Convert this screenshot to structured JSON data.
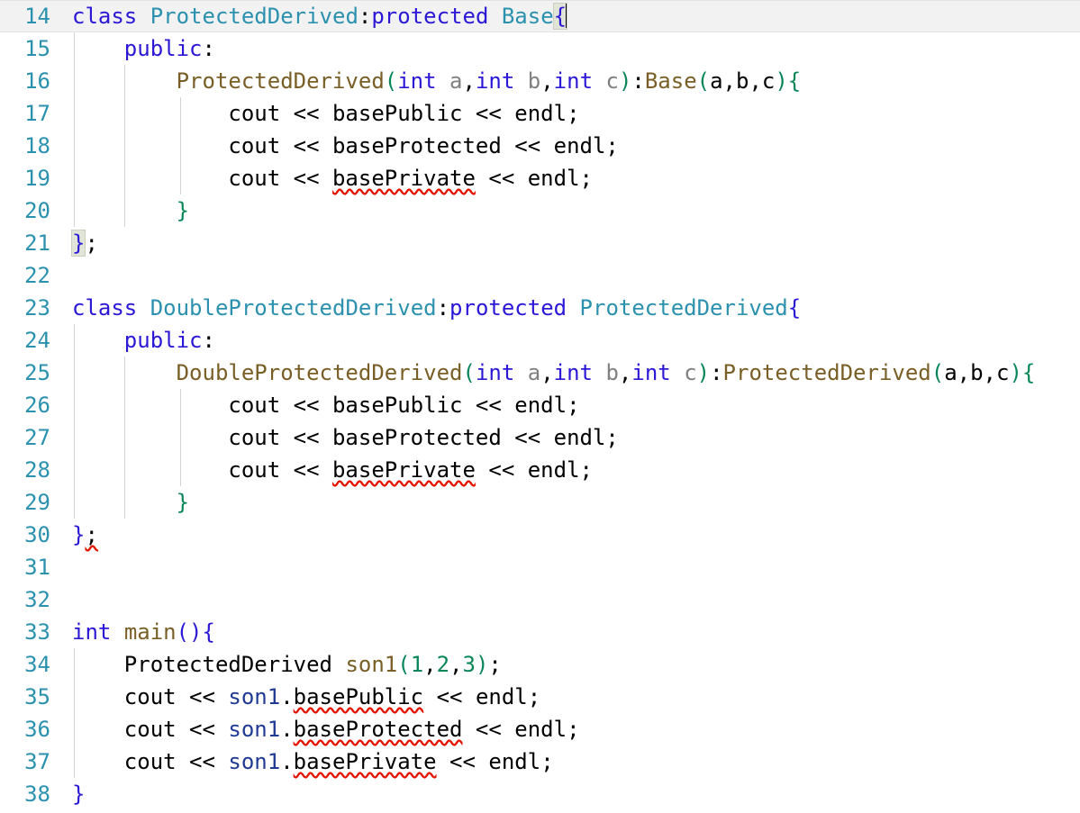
{
  "editor": {
    "language": "cpp",
    "first_line_number": 14,
    "current_line_number": 14,
    "caret": {
      "line": 14,
      "column": 38
    },
    "colors": {
      "background": "#ffffff",
      "line_number": "#2b91af",
      "current_line_highlight": "#f2f2f2",
      "keyword": "#2b18d6",
      "type": "#2b91af",
      "function": "#795e26",
      "parameter": "#808080",
      "variable": "#1f3a93",
      "number": "#098658",
      "plain_text": "#000000",
      "bracket_green": "#098658",
      "bracket_blue": "#2b18d6",
      "error_squiggle": "#e51400",
      "bracket_match_bg": "#e1e5d8",
      "indent_guide": "#d3d3d3",
      "indent_guide_active": "#a0a0a0"
    },
    "lines": [
      {
        "n": "14",
        "text": "class ProtectedDerived:protected Base{",
        "current": true
      },
      {
        "n": "15",
        "text": "    public:"
      },
      {
        "n": "16",
        "text": "        ProtectedDerived(int a,int b,int c):Base(a,b,c){"
      },
      {
        "n": "17",
        "text": "            cout << basePublic << endl;"
      },
      {
        "n": "18",
        "text": "            cout << baseProtected << endl;"
      },
      {
        "n": "19",
        "text": "            cout << basePrivate << endl;"
      },
      {
        "n": "20",
        "text": "        }"
      },
      {
        "n": "21",
        "text": "};"
      },
      {
        "n": "22",
        "text": ""
      },
      {
        "n": "23",
        "text": "class DoubleProtectedDerived:protected ProtectedDerived{"
      },
      {
        "n": "24",
        "text": "    public:"
      },
      {
        "n": "25",
        "text": "        DoubleProtectedDerived(int a,int b,int c):ProtectedDerived(a,b,c){"
      },
      {
        "n": "26",
        "text": "            cout << basePublic << endl;"
      },
      {
        "n": "27",
        "text": "            cout << baseProtected << endl;"
      },
      {
        "n": "28",
        "text": "            cout << basePrivate << endl;"
      },
      {
        "n": "29",
        "text": "        }"
      },
      {
        "n": "30",
        "text": "};"
      },
      {
        "n": "31",
        "text": ""
      },
      {
        "n": "32",
        "text": ""
      },
      {
        "n": "33",
        "text": "int main(){"
      },
      {
        "n": "34",
        "text": "    ProtectedDerived son1(1,2,3);"
      },
      {
        "n": "35",
        "text": "    cout << son1.basePublic << endl;"
      },
      {
        "n": "36",
        "text": "    cout << son1.baseProtected << endl;"
      },
      {
        "n": "37",
        "text": "    cout << son1.basePrivate << endl;"
      },
      {
        "n": "38",
        "text": "}"
      }
    ],
    "errors": [
      {
        "line": "19",
        "token": "basePrivate"
      },
      {
        "line": "28",
        "token": "basePrivate"
      },
      {
        "line": "30",
        "token": ";"
      },
      {
        "line": "35",
        "token": "basePublic"
      },
      {
        "line": "36",
        "token": "baseProtected"
      },
      {
        "line": "37",
        "token": "basePrivate"
      }
    ],
    "line_numbers": [
      "14",
      "15",
      "16",
      "17",
      "18",
      "19",
      "20",
      "21",
      "22",
      "23",
      "24",
      "25",
      "26",
      "27",
      "28",
      "29",
      "30",
      "31",
      "32",
      "33",
      "34",
      "35",
      "36",
      "37",
      "38"
    ]
  }
}
